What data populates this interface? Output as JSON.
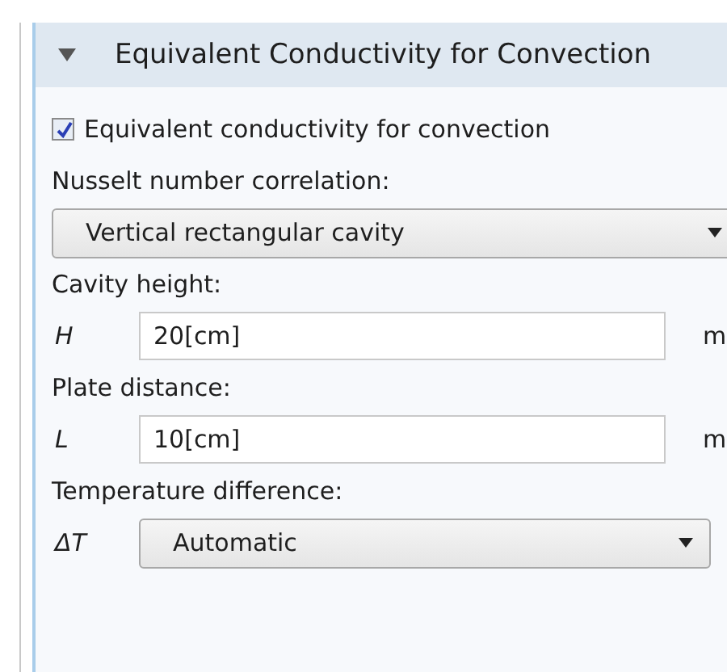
{
  "section": {
    "title": "Equivalent Conductivity for Convection",
    "expanded": true,
    "items": [
      {
        "kind": "checkbox",
        "label": "Equivalent conductivity for convection",
        "checked": true
      },
      {
        "kind": "label",
        "text": "Nusselt number correlation:"
      },
      {
        "kind": "select",
        "value": "Vertical rectangular cavity"
      },
      {
        "kind": "label",
        "text": "Cavity height:"
      },
      {
        "kind": "input",
        "symbol": "H",
        "value": "20[cm]",
        "unit": "m"
      },
      {
        "kind": "label",
        "text": "Plate distance:"
      },
      {
        "kind": "input",
        "symbol": "L",
        "value": "10[cm]",
        "unit": "m"
      },
      {
        "kind": "label",
        "text": "Temperature difference:"
      },
      {
        "kind": "select",
        "symbol": "ΔT",
        "value": "Automatic"
      }
    ]
  }
}
